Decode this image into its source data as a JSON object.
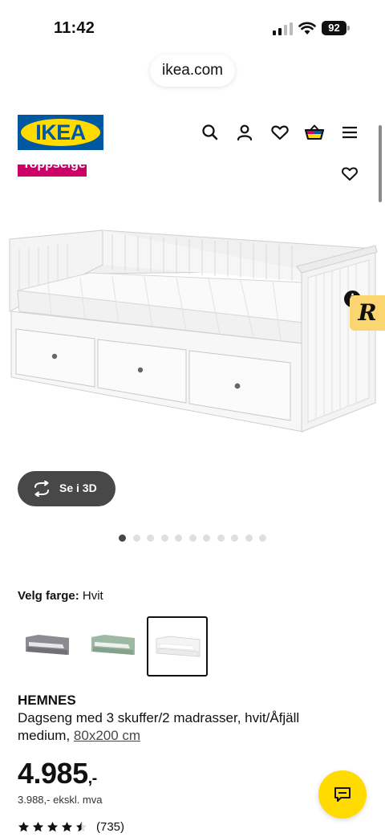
{
  "status_bar": {
    "time": "11:42",
    "battery": "92"
  },
  "browser": {
    "url": "ikea.com"
  },
  "header": {
    "logo_text": "IKEA",
    "icons": [
      "search-icon",
      "user-icon",
      "heart-icon",
      "shopping-bag-icon",
      "menu-icon"
    ]
  },
  "product": {
    "badge": "Toppselger",
    "view_3d_label": "Se i 3D",
    "carousel": {
      "total": 11,
      "active_index": 0
    },
    "color": {
      "label": "Velg farge:",
      "value": "Hvit",
      "options": [
        {
          "name": "Grå",
          "color": "#8a8c90"
        },
        {
          "name": "Grønn",
          "color": "#9db8a3"
        },
        {
          "name": "Hvit",
          "color": "#f4f4f4",
          "selected": true
        }
      ]
    },
    "name": "HEMNES",
    "description": "Dagseng med 3 skuffer/2 madrasser, hvit/Åfjäll medium,",
    "size": "80x200 cm",
    "price_main": "4.985",
    "price_suffix": ",-",
    "price_excl_vat": "3.988,- ekskl. mva",
    "rating": {
      "stars": 4.5,
      "count": "(735)"
    }
  },
  "colors": {
    "ikea_blue": "#0058a3",
    "ikea_yellow": "#ffdb00",
    "badge_red": "#cc0066",
    "dark_button": "#484848"
  }
}
